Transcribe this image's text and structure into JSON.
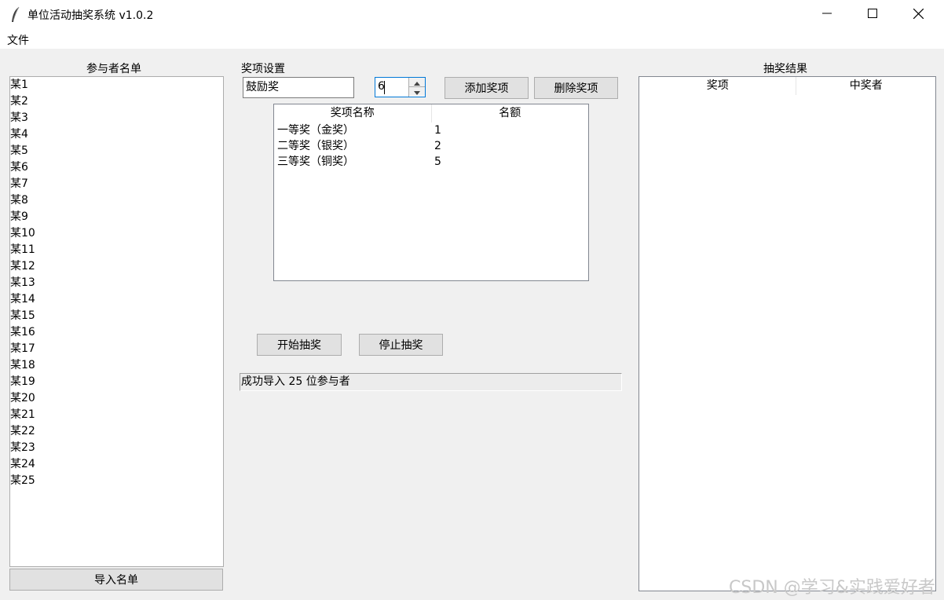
{
  "window": {
    "title": "单位活动抽奖系统 v1.0.2",
    "controls": {
      "minimize": "—",
      "maximize": "☐",
      "close": "✕"
    }
  },
  "menu": {
    "file": "文件"
  },
  "participants": {
    "header": "参与者名单",
    "items": [
      "某1",
      "某2",
      "某3",
      "某4",
      "某5",
      "某6",
      "某7",
      "某8",
      "某9",
      "某10",
      "某11",
      "某12",
      "某13",
      "某14",
      "某15",
      "某16",
      "某17",
      "某18",
      "某19",
      "某20",
      "某21",
      "某22",
      "某23",
      "某24",
      "某25"
    ],
    "import_button": "导入名单"
  },
  "prize_settings": {
    "header": "奖项设置",
    "name_value": "鼓励奖",
    "count_value": "6",
    "add_button": "添加奖项",
    "delete_button": "删除奖项",
    "table": {
      "columns": [
        "奖项名称",
        "名额"
      ],
      "rows": [
        [
          "一等奖（金奖）",
          "1"
        ],
        [
          "二等奖（银奖）",
          "2"
        ],
        [
          "三等奖（铜奖）",
          "5"
        ]
      ]
    }
  },
  "draw": {
    "start_button": "开始抽奖",
    "stop_button": "停止抽奖",
    "status": "成功导入 25 位参与者"
  },
  "results": {
    "header": "抽奖结果",
    "columns": [
      "奖项",
      "中奖者"
    ]
  },
  "watermark": "CSDN @学习&实践爱好者"
}
